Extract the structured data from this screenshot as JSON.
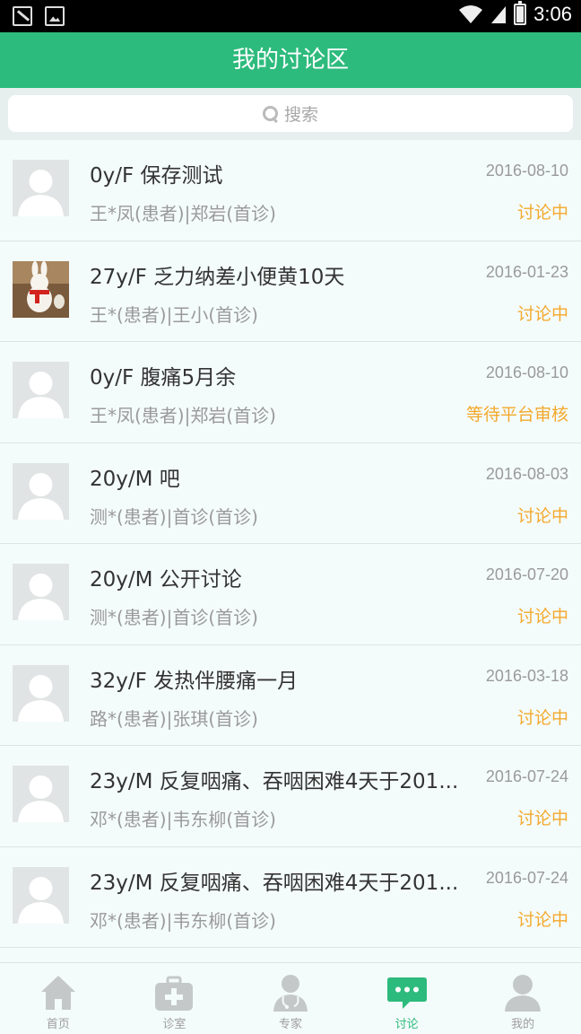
{
  "status_bar": {
    "time": "3:06"
  },
  "header": {
    "title": "我的讨论区"
  },
  "search": {
    "placeholder": "搜索"
  },
  "discussions": [
    {
      "title": "0y/F 保存测试",
      "subtitle": "王*凤(患者)|郑岩(首诊)",
      "date": "2016-08-10",
      "status": "讨论中",
      "avatar": "default"
    },
    {
      "title": "27y/F 乏力纳差小便黄10天",
      "subtitle": "王*(患者)|王小(首诊)",
      "date": "2016-01-23",
      "status": "讨论中",
      "avatar": "photo"
    },
    {
      "title": "0y/F 腹痛5月余",
      "subtitle": "王*凤(患者)|郑岩(首诊)",
      "date": "2016-08-10",
      "status": "等待平台审核",
      "avatar": "default"
    },
    {
      "title": "20y/M 吧",
      "subtitle": "测*(患者)|首诊(首诊)",
      "date": "2016-08-03",
      "status": "讨论中",
      "avatar": "default"
    },
    {
      "title": "20y/M 公开讨论",
      "subtitle": "测*(患者)|首诊(首诊)",
      "date": "2016-07-20",
      "status": "讨论中",
      "avatar": "default"
    },
    {
      "title": "32y/F 发热伴腰痛一月",
      "subtitle": "路*(患者)|张琪(首诊)",
      "date": "2016-03-18",
      "status": "讨论中",
      "avatar": "default"
    },
    {
      "title": "23y/M 反复咽痛、吞咽困难4天于201...",
      "subtitle": "邓*(患者)|韦东柳(首诊)",
      "date": "2016-07-24",
      "status": "讨论中",
      "avatar": "default"
    },
    {
      "title": "23y/M 反复咽痛、吞咽困难4天于201...",
      "subtitle": "邓*(患者)|韦东柳(首诊)",
      "date": "2016-07-24",
      "status": "讨论中",
      "avatar": "default"
    }
  ],
  "tabs": [
    {
      "label": "首页",
      "icon": "home-icon"
    },
    {
      "label": "诊室",
      "icon": "medical-kit-icon"
    },
    {
      "label": "专家",
      "icon": "doctor-icon"
    },
    {
      "label": "讨论",
      "icon": "chat-bubble-icon",
      "active": true
    },
    {
      "label": "我的",
      "icon": "user-icon"
    }
  ],
  "colors": {
    "primary": "#2dbb7d",
    "status": "#f3a92c",
    "text_secondary": "#9a9a9a"
  }
}
